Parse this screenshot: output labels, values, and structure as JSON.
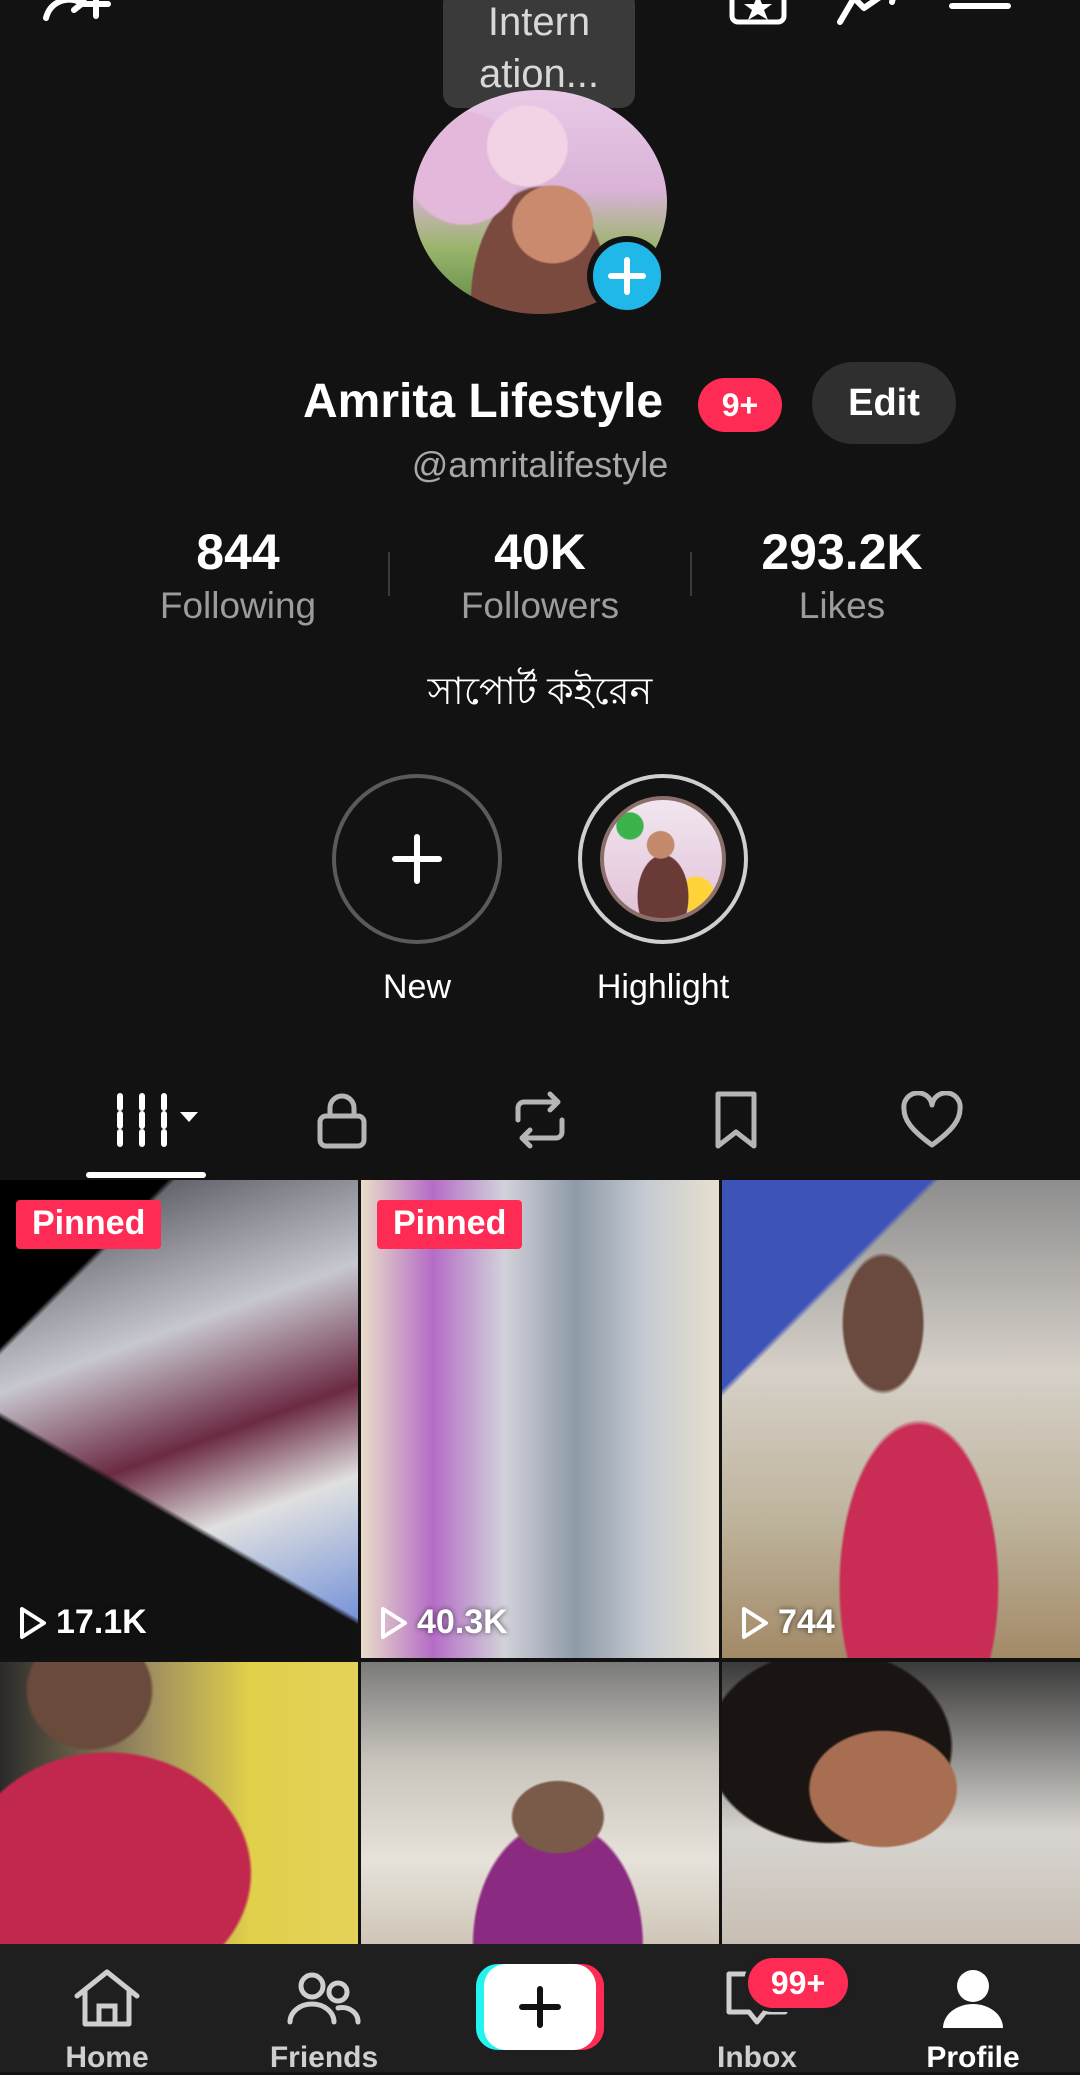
{
  "tooltip": {
    "text": "Intern ation..."
  },
  "profile": {
    "name": "Amrita Lifestyle",
    "notif_badge": "9+",
    "edit_label": "Edit",
    "handle": "@amritalifestyle",
    "bio": "সাপোর্ট কইরেন"
  },
  "stats": [
    {
      "value": "844",
      "label": "Following"
    },
    {
      "value": "40K",
      "label": "Followers"
    },
    {
      "value": "293.2K",
      "label": "Likes"
    }
  ],
  "highlights": [
    {
      "label": "New",
      "icon": "plus-icon"
    },
    {
      "label": "Highlight",
      "icon": "highlight-thumbnail"
    }
  ],
  "tabs": [
    "videos-grid-icon",
    "lock-icon",
    "repost-icon",
    "bookmark-icon",
    "heart-icon"
  ],
  "videos": [
    {
      "pinned": "Pinned",
      "views": "17.1K"
    },
    {
      "pinned": "Pinned",
      "views": "40.3K"
    },
    {
      "pinned": "",
      "views": "744"
    },
    {
      "pinned": "",
      "views": ""
    },
    {
      "pinned": "",
      "views": ""
    },
    {
      "pinned": "",
      "views": ""
    }
  ],
  "nav": {
    "home": "Home",
    "friends": "Friends",
    "inbox": "Inbox",
    "inbox_badge": "99+",
    "profile": "Profile"
  },
  "colors": {
    "background": "#121212",
    "accent_red": "#fe2c55",
    "accent_cyan": "#25f4ee",
    "avatar_plus": "#20b8e8"
  }
}
